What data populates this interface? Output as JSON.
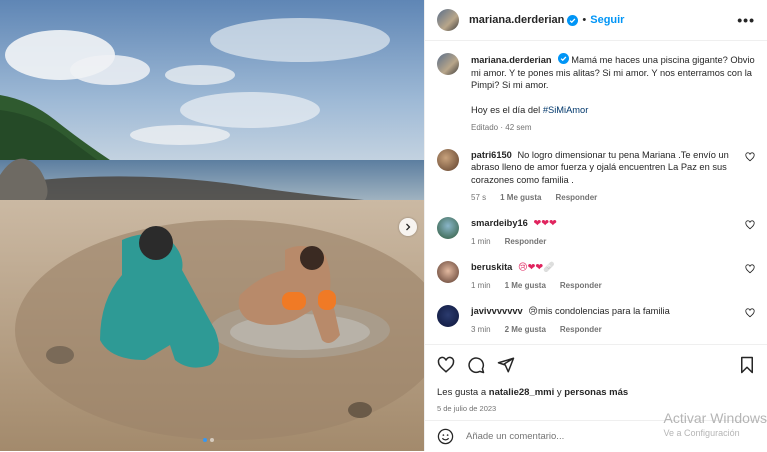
{
  "post": {
    "username": "mariana.derderian",
    "separator": "•",
    "follow_label": "Seguir",
    "more_label": "•••"
  },
  "photo": {
    "slide_dots": 2,
    "active_slide": 1
  },
  "caption": {
    "username": "mariana.derderian",
    "text": "Mamá me haces una piscina gigante? Obvio mi amor. Y te pones mis alitas? Si mi amor. Y nos enterramos con la Pimpi? Si mi amor.",
    "line2_prefix": "Hoy es el día del ",
    "hashtag": "#SiMiAmor",
    "meta": "Editado · 42 sem"
  },
  "comments": [
    {
      "username": "patri6150",
      "text": "No logro dimensionar tu pena Mariana .Te envío un abraso lleno de amor fuerza y ojalá encuentren La Paz en sus corazones como familia .",
      "time": "57 s",
      "likes": "1 Me gusta",
      "reply": "Responder"
    },
    {
      "username": "smardeiby16",
      "text": "",
      "emoji": "❤❤❤",
      "time": "1 min",
      "likes": "",
      "reply": "Responder"
    },
    {
      "username": "beruskita",
      "text": "",
      "emoji": "😢❤❤🩹",
      "time": "1 min",
      "likes": "1 Me gusta",
      "reply": "Responder"
    },
    {
      "username": "javivvvvvvv",
      "text": "mis condolencias para la familia",
      "emoji": "😢",
      "time": "3 min",
      "likes": "2 Me gusta",
      "reply": "Responder"
    }
  ],
  "likes_line": {
    "prefix": "Les gusta a ",
    "user": "natalie28_mmi",
    "suffix": " y ",
    "others": "personas más"
  },
  "date": "5 de julio de 2023",
  "add_comment": {
    "placeholder": "Añade un comentario..."
  },
  "watermark": {
    "line1": "Activar Windows",
    "line2": "Ve a Configuración"
  },
  "colors": {
    "accent": "#0095f6",
    "verified": "#0095f6",
    "heart": "#e0245e"
  }
}
